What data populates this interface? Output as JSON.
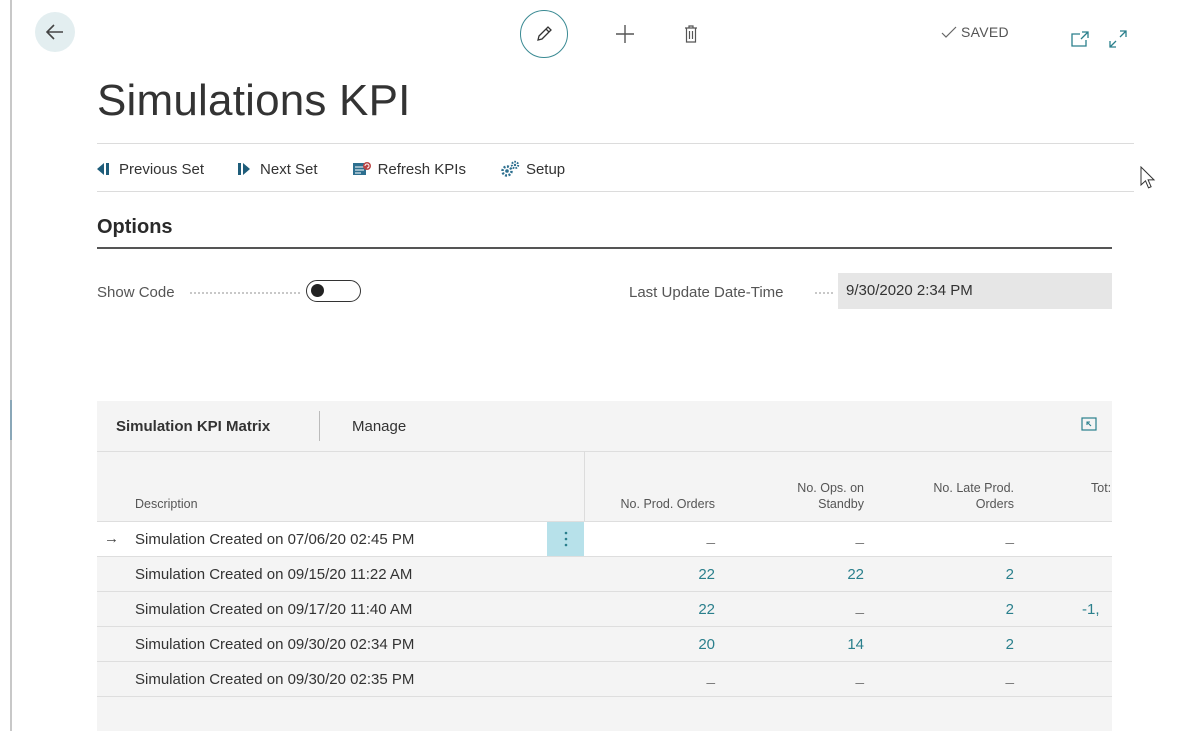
{
  "header": {
    "saved_label": "SAVED",
    "title": "Simulations KPI"
  },
  "icons": {
    "back": "arrow-left-icon",
    "edit": "pencil-icon",
    "new": "plus-icon",
    "delete": "trash-icon",
    "open_new_window": "popout-icon",
    "expand": "expand-icon"
  },
  "actions": [
    {
      "label": "Previous Set",
      "icon": "previous-set-icon"
    },
    {
      "label": "Next Set",
      "icon": "next-set-icon"
    },
    {
      "label": "Refresh KPIs",
      "icon": "refresh-icon"
    },
    {
      "label": "Setup",
      "icon": "gears-icon"
    }
  ],
  "options": {
    "title": "Options",
    "show_code_label": "Show Code",
    "show_code_value": false,
    "last_update_label": "Last Update Date-Time",
    "last_update_value": "9/30/2020 2:34 PM"
  },
  "matrix": {
    "title": "Simulation KPI Matrix",
    "manage_label": "Manage",
    "columns": {
      "description": "Description",
      "prod_orders": "No. Prod. Orders",
      "ops_standby_1": "No. Ops. on",
      "ops_standby_2": "Standby",
      "late_orders_1": "No. Late Prod.",
      "late_orders_2": "Orders",
      "total_partial": "Tot:"
    },
    "rows": [
      {
        "description": "Simulation Created on 07/06/20 02:45 PM",
        "prod_orders": "_",
        "ops_standby": "_",
        "late_orders": "_",
        "total": ""
      },
      {
        "description": "Simulation Created on 09/15/20 11:22 AM",
        "prod_orders": "22",
        "ops_standby": "22",
        "late_orders": "2",
        "total": ""
      },
      {
        "description": "Simulation Created on 09/17/20 11:40 AM",
        "prod_orders": "22",
        "ops_standby": "_",
        "late_orders": "2",
        "total": "-1,"
      },
      {
        "description": "Simulation Created on 09/30/20 02:34 PM",
        "prod_orders": "20",
        "ops_standby": "14",
        "late_orders": "2",
        "total": ""
      },
      {
        "description": "Simulation Created on 09/30/20 02:35 PM",
        "prod_orders": "_",
        "ops_standby": "_",
        "late_orders": "_",
        "total": ""
      }
    ]
  },
  "colors": {
    "accent": "#2a7f8c",
    "selected_row_menu": "#b7e1ea",
    "back_button_bg": "#e3eef0"
  }
}
